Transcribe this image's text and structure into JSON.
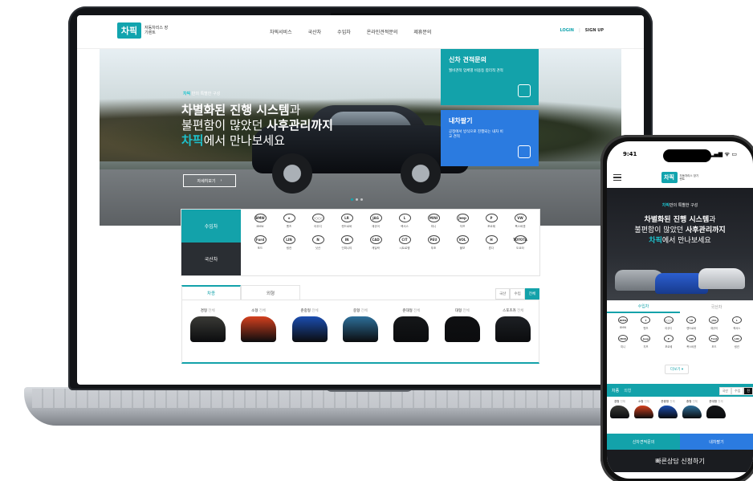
{
  "nav": {
    "logo": "차픽",
    "logo_sub": "자동차리스 장기렌트",
    "menu": [
      "차픽서비스",
      "국산차",
      "수입차",
      "온라인견적문의",
      "제휴문의"
    ],
    "login": "LOGIN",
    "signup": "SIGN UP"
  },
  "hero": {
    "tag_brand": "차픽",
    "tag_text": "만의 특별한 구성",
    "line1_bold": "차별화된 진행 시스템",
    "line1_thin": "과",
    "line2_thin": "불편함이 많았던 ",
    "line2_bold": "사후관리까지",
    "line3_brand": "차픽",
    "line3_thin": "에서 만나보세요",
    "button": "자세히보기",
    "button_arrow": "›"
  },
  "panels": [
    {
      "title": "신차 견적문의",
      "desc": "월비견적 업체별 비용등 합리적 견적"
    },
    {
      "title": "내차팔기",
      "desc": "공정에서 방식으로 진행되는 내차 비교 견적"
    }
  ],
  "brand_section": {
    "tabs": [
      "수입차",
      "국산차"
    ],
    "brands": [
      {
        "logo": "BMW",
        "name": "BMW"
      },
      {
        "logo": "★",
        "name": "벤츠"
      },
      {
        "logo": "○○○○",
        "name": "아우디"
      },
      {
        "logo": "LR",
        "name": "랜드로버"
      },
      {
        "logo": "JAG",
        "name": "재규어"
      },
      {
        "logo": "L",
        "name": "렉서스"
      },
      {
        "logo": "MINI",
        "name": "미니"
      },
      {
        "logo": "Jeep",
        "name": "지프"
      },
      {
        "logo": "P",
        "name": "포르쉐"
      },
      {
        "logo": "VW",
        "name": "폭스바겐"
      },
      {
        "logo": "Ford",
        "name": "포드"
      },
      {
        "logo": "LIN",
        "name": "링컨"
      },
      {
        "logo": "N",
        "name": "닛산"
      },
      {
        "logo": "IN",
        "name": "인피니티"
      },
      {
        "logo": "CAD",
        "name": "캐딜락"
      },
      {
        "logo": "CIT",
        "name": "시트로엥"
      },
      {
        "logo": "PEU",
        "name": "푸조"
      },
      {
        "logo": "VOL",
        "name": "볼보"
      },
      {
        "logo": "H",
        "name": "혼다"
      },
      {
        "logo": "TOYOTA",
        "name": "도요타"
      }
    ]
  },
  "vehicle_section": {
    "tabs": [
      "차종",
      "외형"
    ],
    "filters": [
      "국산",
      "수입",
      "전체"
    ],
    "all_suffix": "전체",
    "items": [
      {
        "label": "경형",
        "color": "#3a3a36"
      },
      {
        "label": "소형",
        "color": "#d4401e"
      },
      {
        "label": "준중형",
        "color": "#1b4db0"
      },
      {
        "label": "중형",
        "color": "#2d6f9a"
      },
      {
        "label": "준대형",
        "color": "#151719"
      },
      {
        "label": "대형",
        "color": "#0f1012"
      },
      {
        "label": "스포츠카",
        "color": "#1d2024"
      }
    ]
  },
  "phone": {
    "time": "9:41",
    "signal": "▂▄▆ ᯤ ▭",
    "logo": "차픽",
    "logo_sub": "자동차리스 장기렌트",
    "tag_brand": "차픽",
    "tag_text": "만의 특별한 구성",
    "line1_bold": "차별화된 진행 시스템",
    "line1_thin": "과",
    "line2_thin": "불편함이 많았던 ",
    "line2_bold": "사후관리까지",
    "line3_brand": "차픽",
    "line3_thin": "에서 만나보세요",
    "tabs": [
      "수입차",
      "국산차"
    ],
    "brands": [
      {
        "logo": "BMW",
        "name": "BMW"
      },
      {
        "logo": "★",
        "name": "벤츠"
      },
      {
        "logo": "○○○○",
        "name": "아우디"
      },
      {
        "logo": "LR",
        "name": "랜드로버"
      },
      {
        "logo": "JAG",
        "name": "재규어"
      },
      {
        "logo": "L",
        "name": "렉서스"
      },
      {
        "logo": "MINI",
        "name": "미니"
      },
      {
        "logo": "Jeep",
        "name": "지프"
      },
      {
        "logo": "P",
        "name": "포르쉐"
      },
      {
        "logo": "VW",
        "name": "폭스바겐"
      },
      {
        "logo": "Ford",
        "name": "포드"
      },
      {
        "logo": "LIN",
        "name": "링컨"
      }
    ],
    "more": "더보기 ▾",
    "bar_tabs": [
      "차종",
      "외형"
    ],
    "bar_filters": [
      "국산",
      "수입",
      "전"
    ],
    "vehicles": [
      {
        "label": "경형",
        "color": "#3a3a36"
      },
      {
        "label": "소형",
        "color": "#d4401e"
      },
      {
        "label": "준중형",
        "color": "#1b4db0"
      },
      {
        "label": "중형",
        "color": "#2d6f9a"
      },
      {
        "label": "준대형",
        "color": "#151719"
      }
    ],
    "all_suffix": "전체",
    "cta1": "신차견적문의",
    "cta2": "내차팔기",
    "consult": "빠른상담 신청하기"
  }
}
